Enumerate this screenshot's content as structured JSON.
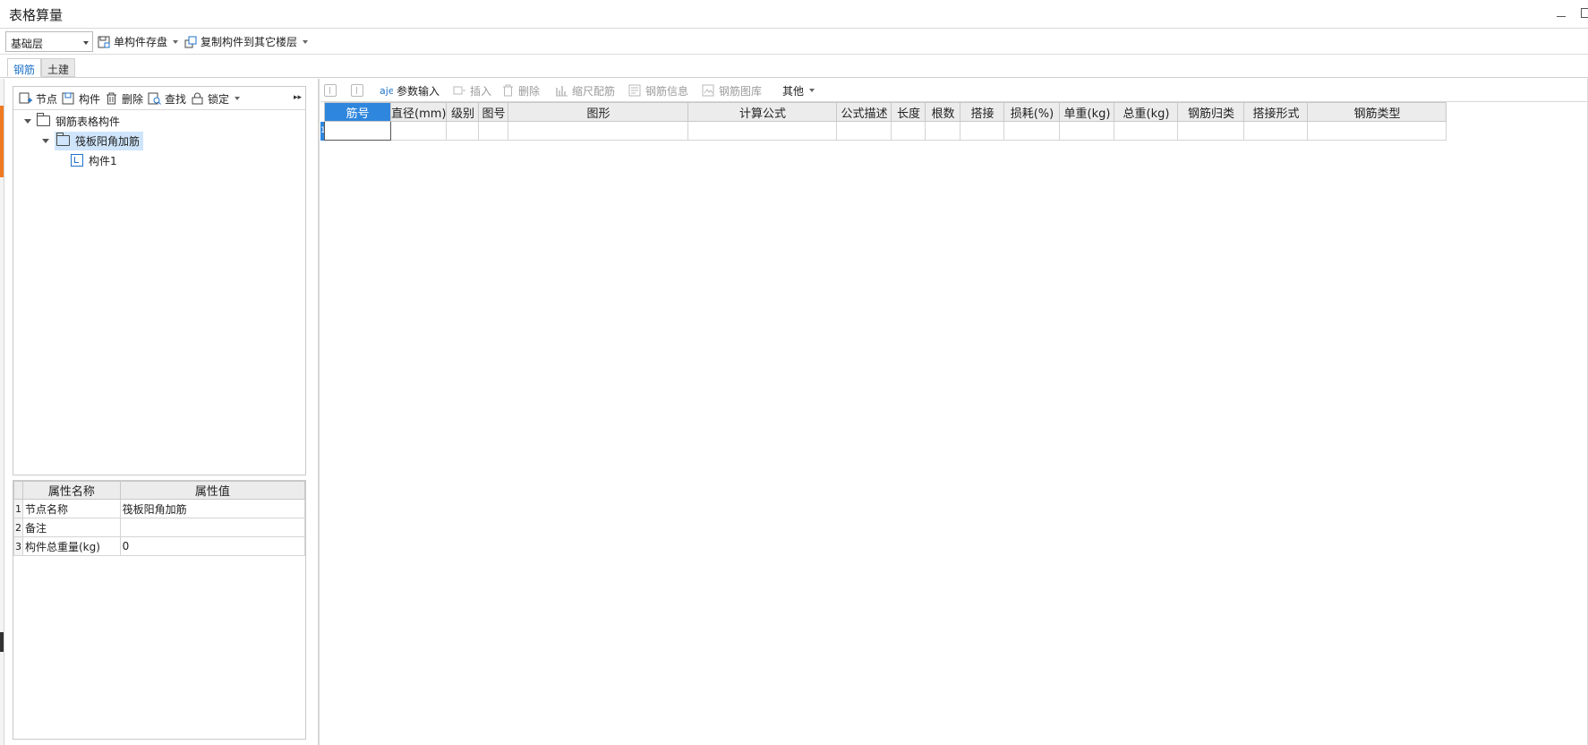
{
  "window": {
    "title": "表格算量"
  },
  "toolbar": {
    "floor_select": "基础层",
    "save_component": "单构件存盘",
    "copy_to_floor": "复制构件到其它楼层"
  },
  "tabs": [
    "钢筋",
    "土建"
  ],
  "left_toolbar": {
    "node": "节点",
    "component": "构件",
    "delete": "删除",
    "find": "查找",
    "lock": "锁定"
  },
  "tree": {
    "root": "钢筋表格构件",
    "child": "筏板阳角加筋",
    "leaf": "构件1"
  },
  "properties": {
    "headers": [
      "属性名称",
      "属性值"
    ],
    "rows": [
      {
        "idx": "1",
        "name": "节点名称",
        "value": "筏板阳角加筋"
      },
      {
        "idx": "2",
        "name": "备注",
        "value": ""
      },
      {
        "idx": "3",
        "name": "构件总重量(kg)",
        "value": "0"
      }
    ]
  },
  "grid_toolbar": {
    "param_input": "参数输入",
    "insert": "插入",
    "delete": "删除",
    "scale_rebar": "缩尺配筋",
    "rebar_info": "钢筋信息",
    "rebar_library": "钢筋图库",
    "other": "其他"
  },
  "grid": {
    "columns": [
      "筋号",
      "直径(mm)",
      "级别",
      "图号",
      "图形",
      "计算公式",
      "公式描述",
      "长度",
      "根数",
      "搭接",
      "损耗(%)",
      "单重(kg)",
      "总重(kg)",
      "钢筋归类",
      "搭接形式",
      "钢筋类型"
    ],
    "row_index": "1"
  }
}
